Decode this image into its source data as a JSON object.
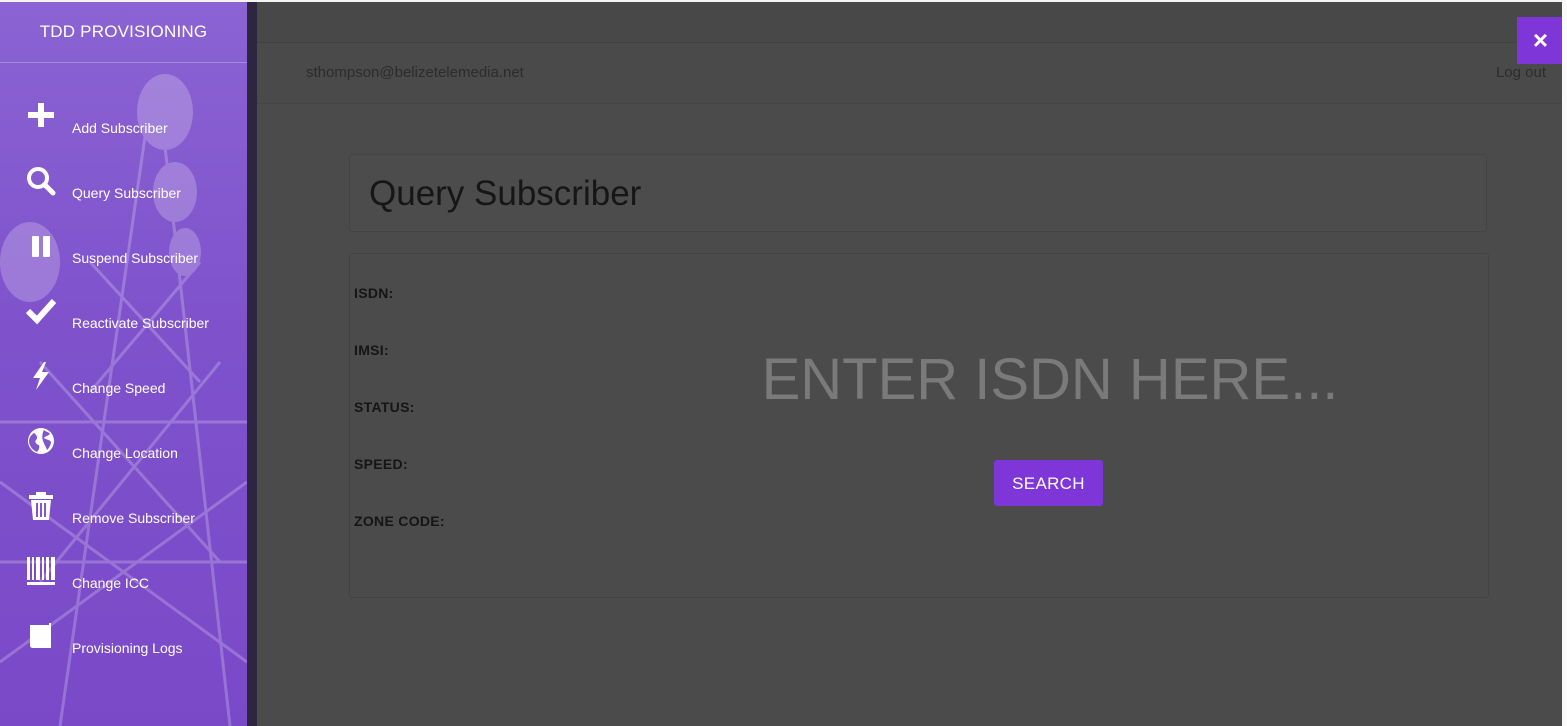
{
  "sidebar": {
    "title": "TDD PROVISIONING",
    "items": [
      {
        "label": "Add Subscriber",
        "icon": "plus-icon"
      },
      {
        "label": "Query Subscriber",
        "icon": "search-icon"
      },
      {
        "label": "Suspend Subscriber",
        "icon": "pause-icon"
      },
      {
        "label": "Reactivate Subscriber",
        "icon": "check-icon"
      },
      {
        "label": "Change Speed",
        "icon": "bolt-icon"
      },
      {
        "label": "Change Location",
        "icon": "globe-icon"
      },
      {
        "label": "Remove Subscriber",
        "icon": "trash-icon"
      },
      {
        "label": "Change ICC",
        "icon": "barcode-icon"
      },
      {
        "label": "Provisioning Logs",
        "icon": "book-icon"
      }
    ]
  },
  "header": {
    "user_email": "sthompson@belizetelemedia.net",
    "logout_label": "Log out",
    "close_label": "×"
  },
  "main": {
    "page_title": "Query Subscriber",
    "fields": {
      "isdn": "ISDN:",
      "imsi": "IMSI:",
      "status": "STATUS:",
      "speed": "SPEED:",
      "zone_code": "ZONE CODE:"
    },
    "isdn_input": {
      "placeholder": "ENTER ISDN HERE...",
      "value": ""
    },
    "search_label": "SEARCH"
  },
  "colors": {
    "accent": "#7e36d8",
    "sidebar": "#8057cc",
    "overlay": "#4b4b4b"
  }
}
